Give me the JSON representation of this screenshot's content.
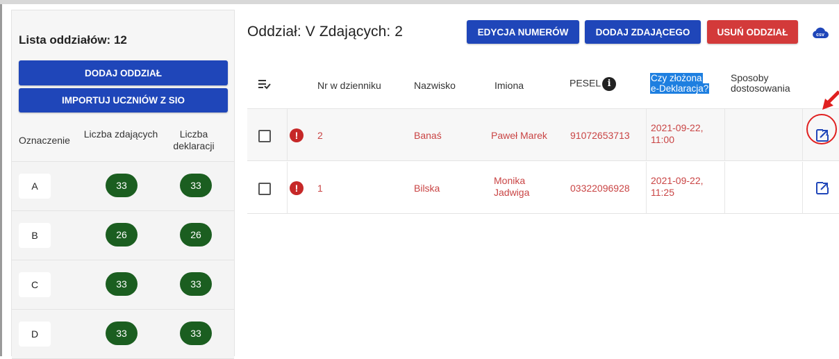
{
  "sidebar": {
    "title": "Lista oddziałów: 12",
    "add_button": "DODAJ ODDZIAŁ",
    "import_button": "IMPORTUJ UCZNIÓW Z SIO",
    "columns": [
      "Oznaczenie",
      "Liczba zdających",
      "Liczba deklaracji"
    ],
    "rows": [
      {
        "code": "A",
        "examinees": "33",
        "declarations": "33"
      },
      {
        "code": "B",
        "examinees": "26",
        "declarations": "26"
      },
      {
        "code": "C",
        "examinees": "33",
        "declarations": "33"
      },
      {
        "code": "D",
        "examinees": "33",
        "declarations": "33"
      }
    ]
  },
  "header": {
    "title": "Oddział: V Zdających: 2",
    "edit_numbers_button": "EDYCJA NUMERÓW",
    "add_examinee_button": "DODAJ ZDAJĄCEGO",
    "delete_button": "USUŃ ODDZIAŁ",
    "csv_icon": "csv-cloud-icon",
    "csv_label": "csv"
  },
  "table": {
    "columns": {
      "number": "Nr w dzienniku",
      "surname": "Nazwisko",
      "names": "Imiona",
      "pesel": "PESEL",
      "declared_line1": "Czy złożona",
      "declared_line2": "e-Deklaracja?",
      "adjust_line1": "Sposoby",
      "adjust_line2": "dostosowania"
    },
    "rows": [
      {
        "number": "2",
        "surname": "Banaś",
        "names_line1": "Paweł Marek",
        "names_line2": "",
        "pesel": "91072653713",
        "declared_line1": "2021-09-22,",
        "declared_line2": "11:00"
      },
      {
        "number": "1",
        "surname": "Bilska",
        "names_line1": "Monika",
        "names_line2": "Jadwiga",
        "pesel": "03322096928",
        "declared_line1": "2021-09-22,",
        "declared_line2": "11:25"
      }
    ]
  },
  "colors": {
    "primary": "#1f46b9",
    "danger": "#d33a3a",
    "badge": "#1b5e20",
    "error_text": "#c94444",
    "highlight": "#1e7fe0"
  }
}
